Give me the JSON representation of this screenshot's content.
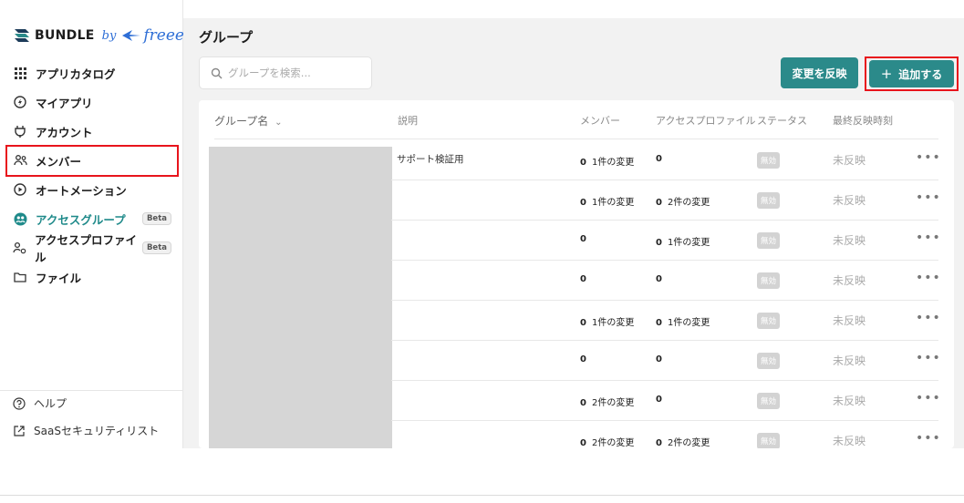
{
  "brand": {
    "name": "BUNDLE",
    "by": "by",
    "partner": "freee"
  },
  "sidebar": {
    "items": [
      {
        "label": "アプリカタログ",
        "icon": "grid-icon"
      },
      {
        "label": "マイアプリ",
        "icon": "bolt-icon"
      },
      {
        "label": "アカウント",
        "icon": "plug-icon"
      },
      {
        "label": "メンバー",
        "icon": "people-icon"
      },
      {
        "label": "オートメーション",
        "icon": "play-circle-icon"
      },
      {
        "label": "アクセスグループ",
        "icon": "group-icon",
        "badge": "Beta",
        "active": true
      },
      {
        "label": "アクセスプロファイル",
        "icon": "profile-icon",
        "badge": "Beta"
      },
      {
        "label": "ファイル",
        "icon": "folder-icon"
      }
    ],
    "help": "ヘルプ",
    "saas_list": "SaaSセキュリティリスト"
  },
  "header": {
    "title": "グループ"
  },
  "search": {
    "placeholder": "グループを検索..."
  },
  "buttons": {
    "apply": "変更を反映",
    "add": "追加する"
  },
  "table": {
    "columns": {
      "name": "グループ名",
      "description": "説明",
      "members": "メンバー",
      "profiles": "アクセスプロファイル",
      "status": "ステータス",
      "last_applied": "最終反映時刻"
    },
    "rows": [
      {
        "description": "サポート検証用",
        "members": "0",
        "members_change": "1件の変更",
        "profiles": "0",
        "profiles_change": "",
        "status": "無効",
        "last_applied": "未反映"
      },
      {
        "description": "",
        "members": "0",
        "members_change": "1件の変更",
        "profiles": "0",
        "profiles_change": "2件の変更",
        "status": "無効",
        "last_applied": "未反映"
      },
      {
        "description": "",
        "members": "0",
        "members_change": "",
        "profiles": "0",
        "profiles_change": "1件の変更",
        "status": "無効",
        "last_applied": "未反映"
      },
      {
        "description": "",
        "members": "0",
        "members_change": "",
        "profiles": "0",
        "profiles_change": "",
        "status": "無効",
        "last_applied": "未反映"
      },
      {
        "description": "",
        "members": "0",
        "members_change": "1件の変更",
        "profiles": "0",
        "profiles_change": "1件の変更",
        "status": "無効",
        "last_applied": "未反映"
      },
      {
        "description": "",
        "members": "0",
        "members_change": "",
        "profiles": "0",
        "profiles_change": "",
        "status": "無効",
        "last_applied": "未反映"
      },
      {
        "description": "",
        "members": "0",
        "members_change": "2件の変更",
        "profiles": "0",
        "profiles_change": "",
        "status": "無効",
        "last_applied": "未反映"
      },
      {
        "description": "",
        "members": "0",
        "members_change": "2件の変更",
        "profiles": "0",
        "profiles_change": "2件の変更",
        "status": "無効",
        "last_applied": "未反映"
      }
    ],
    "more_label": "•••"
  },
  "colors": {
    "accent": "#2b8a8a",
    "highlight": "#e8141c",
    "active_text": "#1f8a8a"
  }
}
